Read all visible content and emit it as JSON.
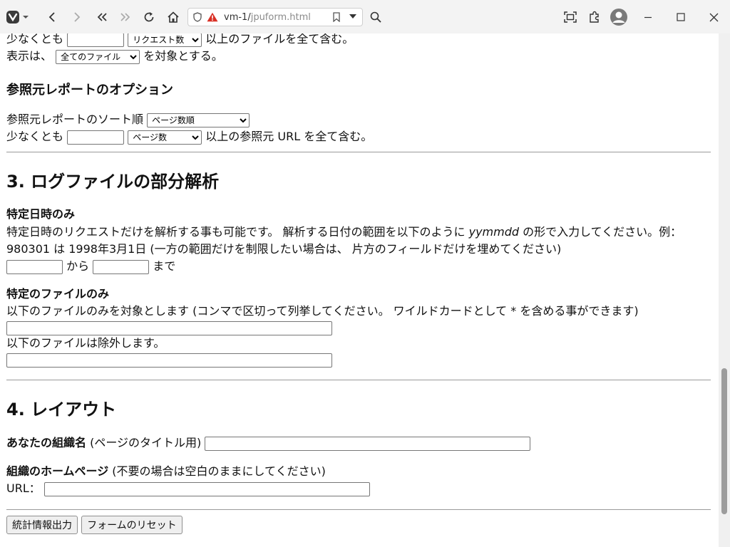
{
  "browser": {
    "url_host": "vm-1/",
    "url_path": "jpuform.html"
  },
  "top": {
    "line1_prefix": "少なくとも",
    "line1_select": "リクエスト数",
    "line1_suffix": "以上のファイルを全て含む。",
    "line2_prefix": "表示は、",
    "line2_select": "全てのファイル",
    "line2_suffix": "を対象とする。"
  },
  "referrer": {
    "heading": "参照元レポートのオプション",
    "sort_label": "参照元レポートのソート順",
    "sort_select": "ページ数順",
    "min_prefix": "少なくとも",
    "min_select": "ページ数",
    "min_suffix": "以上の参照元 URL を全て含む。"
  },
  "section3": {
    "heading": "3. ログファイルの部分解析",
    "date_heading": "特定日時のみ",
    "date_desc_a": "特定日時のリクエストだけを解析する事も可能です。 解析する日付の範囲を以下のように",
    "date_desc_em": "yymmdd",
    "date_desc_b": "の形で入力してください。例：",
    "date_desc_line2": "980301 は 1998年3月1日 (一方の範囲だけを制限したい場合は、 片方のフィールドだけを埋めてください)",
    "from_label": "から",
    "to_label": "まで",
    "file_heading": "特定のファイルのみ",
    "file_desc": "以下のファイルのみを対象とします (コンマで区切って列挙してください。 ワイルドカードとして * を含める事ができます)",
    "exclude_label": "以下のファイルは除外します。"
  },
  "section4": {
    "heading": "4. レイアウト",
    "org_label": "あなたの組織名",
    "org_hint": "(ページのタイトル用)",
    "home_label": "組織のホームページ",
    "home_hint": "(不要の場合は空白のままにしてください)",
    "url_label": "URL："
  },
  "buttons": {
    "submit": "統計情報出力",
    "reset": "フォームのリセット"
  }
}
